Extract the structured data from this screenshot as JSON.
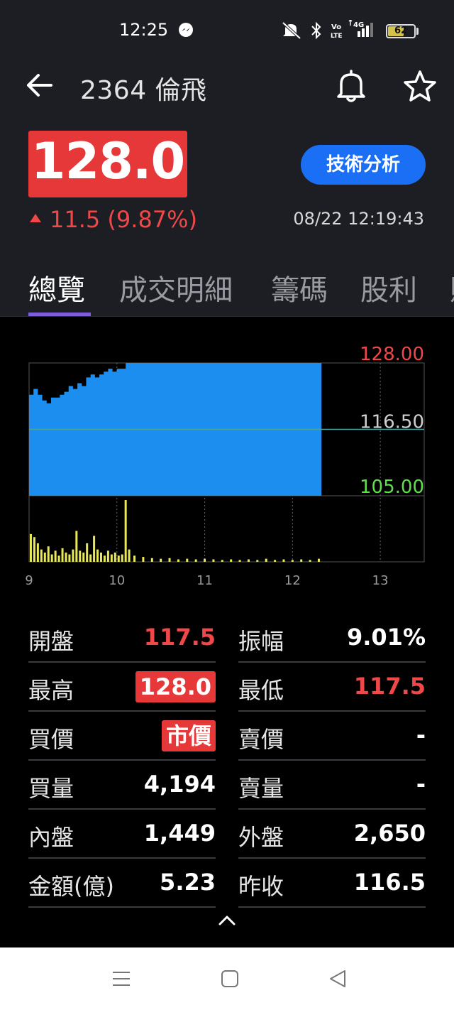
{
  "status_bar": {
    "time": "12:25",
    "battery": "62",
    "battery_level": 0.62,
    "icons": [
      "messenger-icon",
      "mute-icon",
      "bluetooth-icon",
      "volte-icon",
      "4g-signal-icon",
      "battery-icon"
    ]
  },
  "header": {
    "title": "2364 倫飛"
  },
  "quote": {
    "price": "128.0",
    "change": "11.5 (9.87%)",
    "timestamp": "08/22 12:19:43",
    "tech_button": "技術分析"
  },
  "tabs": [
    {
      "label": "總覽",
      "active": true
    },
    {
      "label": "成交明細",
      "active": false
    },
    {
      "label": "籌碼",
      "active": false
    },
    {
      "label": "股利",
      "active": false
    },
    {
      "label": "財",
      "active": false
    }
  ],
  "colors": {
    "up": "#f04848",
    "down": "#5ee04a",
    "accent": "#7d5ed8",
    "button": "#1b6ff5",
    "area": "#1b8ef0",
    "volume": "#e8e85a"
  },
  "chart_data": {
    "type": "area",
    "price_axis": {
      "top": "128.00",
      "mid": "116.50",
      "bottom": "105.00",
      "ylim": [
        105,
        128
      ],
      "reference": 116.5
    },
    "x_ticks": [
      "9",
      "10",
      "11",
      "12",
      "13"
    ],
    "xlim": [
      9,
      13.5
    ],
    "price_series": {
      "x": [
        9.0,
        9.05,
        9.1,
        9.15,
        9.2,
        9.25,
        9.3,
        9.35,
        9.4,
        9.45,
        9.5,
        9.55,
        9.6,
        9.65,
        9.7,
        9.75,
        9.8,
        9.85,
        9.9,
        9.95,
        10.0,
        10.05,
        10.1,
        12.33
      ],
      "y": [
        122.5,
        123.5,
        122.5,
        121.5,
        121.0,
        122.0,
        122.0,
        122.5,
        123.0,
        124.0,
        123.5,
        124.5,
        124.0,
        125.5,
        126.0,
        125.5,
        126.0,
        126.5,
        127.0,
        126.5,
        127.0,
        127.0,
        128.0,
        128.0
      ]
    },
    "volume_series": {
      "x": [
        9.02,
        9.06,
        9.1,
        9.14,
        9.18,
        9.22,
        9.26,
        9.3,
        9.34,
        9.38,
        9.42,
        9.46,
        9.5,
        9.54,
        9.58,
        9.62,
        9.66,
        9.7,
        9.74,
        9.78,
        9.82,
        9.86,
        9.9,
        9.94,
        9.98,
        10.02,
        10.06,
        10.1,
        10.14,
        10.2,
        10.3,
        10.4,
        10.5,
        10.6,
        10.7,
        10.8,
        10.9,
        11.0,
        11.1,
        11.2,
        11.3,
        11.4,
        11.5,
        11.6,
        11.7,
        11.8,
        11.9,
        12.0,
        12.1,
        12.2,
        12.3
      ],
      "v": [
        0.45,
        0.4,
        0.3,
        0.2,
        0.15,
        0.25,
        0.12,
        0.18,
        0.1,
        0.22,
        0.15,
        0.12,
        0.2,
        0.5,
        0.18,
        0.15,
        0.3,
        0.12,
        0.42,
        0.2,
        0.15,
        0.1,
        0.18,
        0.12,
        0.15,
        0.1,
        0.12,
        1.0,
        0.2,
        0.1,
        0.08,
        0.06,
        0.05,
        0.06,
        0.04,
        0.05,
        0.04,
        0.05,
        0.04,
        0.03,
        0.04,
        0.03,
        0.04,
        0.03,
        0.05,
        0.03,
        0.04,
        0.03,
        0.04,
        0.03,
        0.05
      ]
    }
  },
  "stats": [
    {
      "l_label": "開盤",
      "l_value": "117.5",
      "l_style": "red",
      "r_label": "振幅",
      "r_value": "9.01%",
      "r_style": "white"
    },
    {
      "l_label": "最高",
      "l_value": "128.0",
      "l_style": "badge",
      "r_label": "最低",
      "r_value": "117.5",
      "r_style": "red"
    },
    {
      "l_label": "買價",
      "l_value": "市價",
      "l_style": "badge",
      "r_label": "賣價",
      "r_value": "-",
      "r_style": "white"
    },
    {
      "l_label": "買量",
      "l_value": "4,194",
      "l_style": "white",
      "r_label": "賣量",
      "r_value": "-",
      "r_style": "white"
    },
    {
      "l_label": "內盤",
      "l_value": "1,449",
      "l_style": "white",
      "r_label": "外盤",
      "r_value": "2,650",
      "r_style": "white"
    },
    {
      "l_label": "金額(億)",
      "l_value": "5.23",
      "l_style": "white",
      "r_label": "昨收",
      "r_value": "116.5",
      "r_style": "white"
    }
  ]
}
